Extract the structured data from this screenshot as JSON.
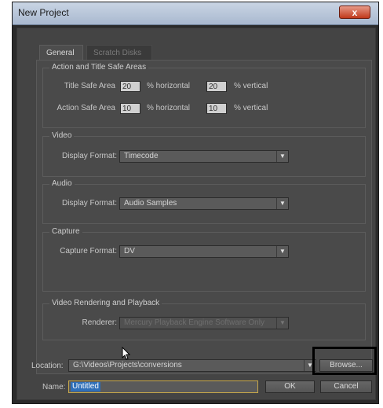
{
  "window": {
    "title": "New Project",
    "close_glyph": "x"
  },
  "tabs": [
    {
      "label": "General",
      "active": true
    },
    {
      "label": "Scratch Disks",
      "active": false
    }
  ],
  "safe_areas": {
    "title": "Action and Title Safe Areas",
    "title_safe_label": "Title Safe Area",
    "title_safe_h": "20",
    "title_safe_v": "20",
    "action_safe_label": "Action Safe Area",
    "action_safe_h": "10",
    "action_safe_v": "10",
    "h_unit": "% horizontal",
    "v_unit": "% vertical"
  },
  "video": {
    "title": "Video",
    "label": "Display Format:",
    "value": "Timecode"
  },
  "audio": {
    "title": "Audio",
    "label": "Display Format:",
    "value": "Audio Samples"
  },
  "capture": {
    "title": "Capture",
    "label": "Capture Format:",
    "value": "DV"
  },
  "rendering": {
    "title": "Video Rendering and Playback",
    "label": "Renderer:",
    "value": "Mercury Playback Engine Software Only"
  },
  "location": {
    "label": "Location:",
    "value": "G:\\Videos\\Projects\\conversions",
    "browse": "Browse..."
  },
  "name": {
    "label": "Name:",
    "value": "Untitled"
  },
  "buttons": {
    "ok": "OK",
    "cancel": "Cancel"
  },
  "colors": {
    "dialog_bg": "#444444",
    "panel_bg": "#4a4a4a",
    "titlebar": "#b9c7da",
    "close": "#c8452a",
    "highlight": "#2f6fb8"
  }
}
